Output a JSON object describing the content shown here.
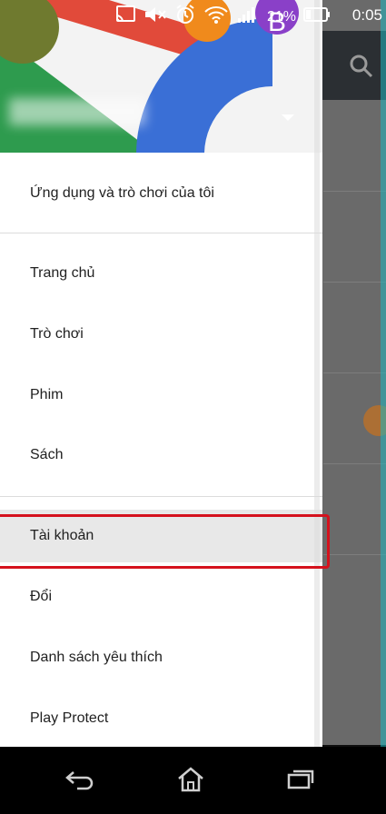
{
  "status_bar": {
    "battery_percent": "21%",
    "time": "0:05",
    "icons": [
      "cast-icon",
      "mute-icon",
      "alarm-icon",
      "wifi-icon",
      "signal-icon",
      "battery-icon"
    ]
  },
  "drawer": {
    "header_avatar_letter": "B",
    "menu": {
      "my_apps": "Ứng dụng và trò chơi của tôi",
      "home": "Trang chủ",
      "games": "Trò chơi",
      "movies": "Phim",
      "books": "Sách",
      "account": "Tài khoản",
      "redeem": "Đổi",
      "wishlist": "Danh sách yêu thích",
      "play_protect": "Play Protect"
    },
    "selected_item": "account"
  },
  "colors": {
    "highlight": "#d5121d",
    "toolbar": "#2b2f33",
    "drawer_bg": "#ffffff"
  },
  "navigation_bar": {
    "buttons": [
      "back-icon",
      "home-icon",
      "recents-icon"
    ]
  }
}
